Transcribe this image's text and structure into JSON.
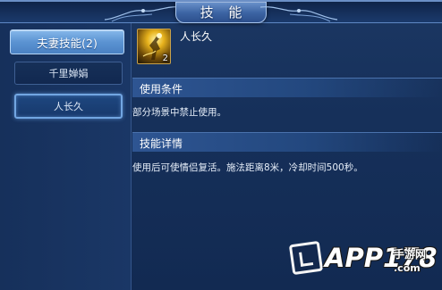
{
  "window": {
    "title": "技 能"
  },
  "sidebar": {
    "category_tab": "夫妻技能(2)",
    "skills": [
      {
        "label": "千里婵娟"
      },
      {
        "label": "人长久"
      }
    ]
  },
  "skill": {
    "name": "人长久",
    "level": "2",
    "icon": "glowing-figure-icon"
  },
  "sections": {
    "condition": {
      "heading": "使用条件",
      "text": "部分场景中禁止使用。"
    },
    "detail": {
      "heading": "技能详情",
      "text": "使用后可使情侣复活。施法距离8米，冷却时间500秒。"
    }
  },
  "watermark": {
    "main": "APP178",
    "sub_cn": "手游网",
    "sub_url": ".com"
  },
  "colors": {
    "window_bg": "#16305a",
    "tab_active": "#5b93d2",
    "selected_border": "#72a6e2",
    "section_head": "#2e5592",
    "icon_gold": "#e7b21c"
  }
}
